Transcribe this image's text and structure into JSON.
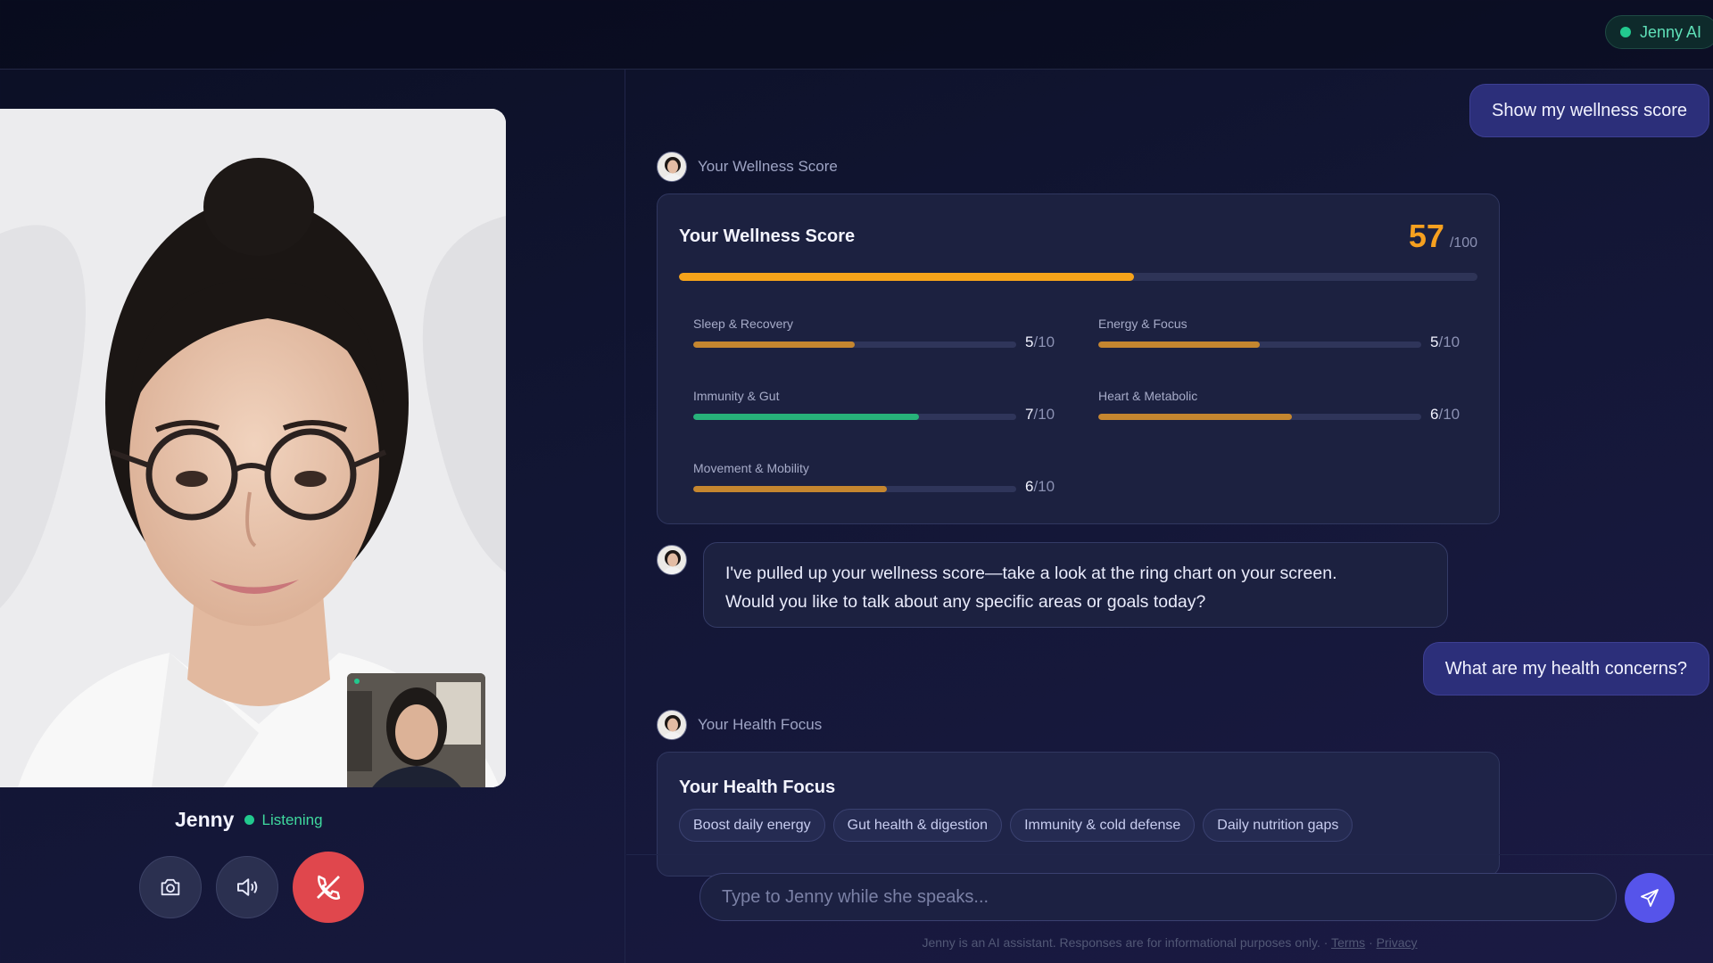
{
  "header": {
    "ai_badge": "Jenny AI"
  },
  "call": {
    "caller_name": "Jenny",
    "status": "Listening",
    "controls": {
      "camera": "camera-icon",
      "speaker": "speaker-icon",
      "end": "end-call-icon"
    }
  },
  "chat": {
    "user_msg_1": "Show my wellness score",
    "card1_sender": "Your Wellness Score",
    "wellness": {
      "title": "Your Wellness Score",
      "score": "57",
      "score_max": "/100",
      "score_fraction": 0.57,
      "metrics": [
        {
          "label": "Sleep & Recovery",
          "value": "5",
          "max": "/10",
          "fraction": 0.5,
          "color": "#c5862f"
        },
        {
          "label": "Energy & Focus",
          "value": "5",
          "max": "/10",
          "fraction": 0.5,
          "color": "#c5862f"
        },
        {
          "label": "Immunity & Gut",
          "value": "7",
          "max": "/10",
          "fraction": 0.7,
          "color": "#27b27a"
        },
        {
          "label": "Heart & Metabolic",
          "value": "6",
          "max": "/10",
          "fraction": 0.6,
          "color": "#c5862f"
        },
        {
          "label": "Movement & Mobility",
          "value": "6",
          "max": "/10",
          "fraction": 0.6,
          "color": "#c5862f"
        }
      ]
    },
    "ai_msg_1_line1": "I've pulled up your wellness score—take a look at the ring chart on your screen.",
    "ai_msg_1_line2": "Would you like to talk about any specific areas or goals today?",
    "user_msg_2": "What are my health concerns?",
    "card2_sender": "Your Health Focus",
    "focus": {
      "title": "Your Health Focus",
      "chips": [
        "Boost daily energy",
        "Gut health & digestion",
        "Immunity & cold defense",
        "Daily nutrition gaps"
      ]
    }
  },
  "composer": {
    "placeholder": "Type to Jenny while she speaks...",
    "disclaimer": "Jenny is an AI assistant. Responses are for informational purposes only.",
    "sep": "·",
    "terms": "Terms",
    "privacy": "Privacy"
  },
  "colors": {
    "accent": "#5654ea",
    "score": "#f6a01f",
    "online": "#22c98e",
    "end_call": "#e0474d"
  }
}
